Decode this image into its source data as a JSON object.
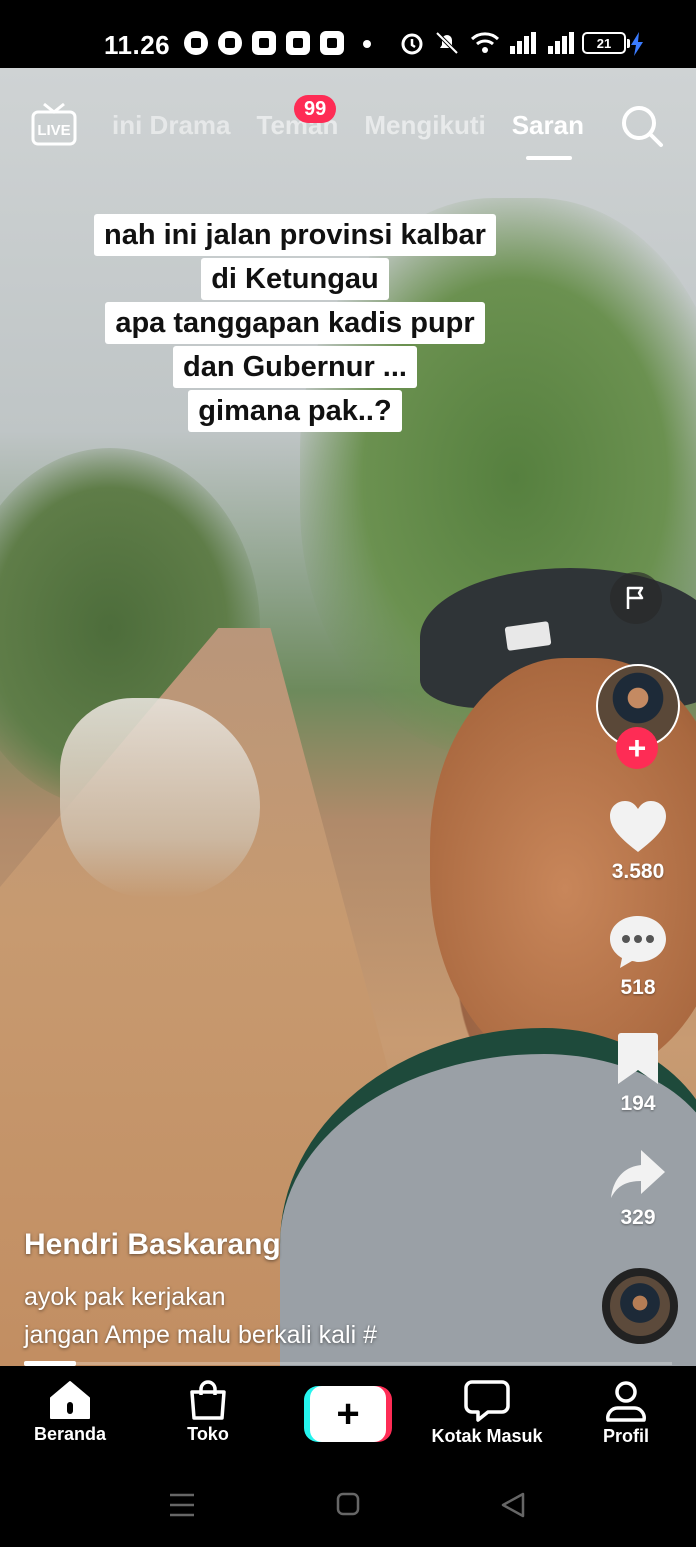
{
  "status_bar": {
    "time": "11.26",
    "battery": "21",
    "app_icons": [
      "facebook-icon",
      "whatsapp-icon",
      "app-icon",
      "youtube-icon",
      "app-r-icon"
    ],
    "system_icons": [
      "alarm-icon",
      "mute-icon",
      "wifi-icon",
      "signal-icon",
      "signal-icon",
      "battery-icon",
      "charging-icon"
    ]
  },
  "top_nav": {
    "tabs": [
      {
        "label": "ini Drama"
      },
      {
        "label": "Teman"
      },
      {
        "label": "Mengikuti"
      },
      {
        "label": "Saran"
      }
    ],
    "badge": "99",
    "active_tab": "Saran"
  },
  "caption": {
    "lines": [
      "nah ini jalan provinsi kalbar",
      "di Ketungau",
      "apa tanggapan kadis pupr",
      "dan Gubernur ...",
      "gimana pak..?"
    ]
  },
  "actions": {
    "likes": "3.580",
    "comments": "518",
    "bookmarks": "194",
    "shares": "329"
  },
  "post": {
    "author": "Hendri Baskarang",
    "description_line1": "ayok pak kerjakan",
    "description_line2": "jangan Ampe malu berkali kali #",
    "progress": 0.08
  },
  "bottom_nav": {
    "items": [
      {
        "label": "Beranda",
        "icon": "home-icon"
      },
      {
        "label": "Toko",
        "icon": "shopping-bag-icon"
      },
      {
        "label": "",
        "icon": "plus-icon"
      },
      {
        "label": "Kotak Masuk",
        "icon": "message-icon"
      },
      {
        "label": "Profil",
        "icon": "profile-icon"
      }
    ]
  },
  "colors": {
    "accent": "#fe2c55",
    "cyan": "#25f4ee"
  }
}
